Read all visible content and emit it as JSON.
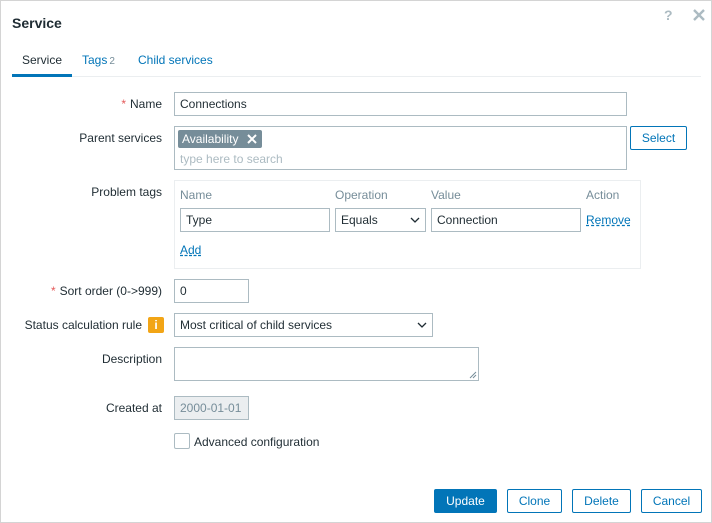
{
  "dialog": {
    "title": "Service",
    "help": "?"
  },
  "tabs": [
    {
      "label": "Service",
      "count": ""
    },
    {
      "label": "Tags",
      "count": "2"
    },
    {
      "label": "Child services",
      "count": ""
    }
  ],
  "form": {
    "name": {
      "label": "Name",
      "value": "Connections"
    },
    "parent_services": {
      "label": "Parent services",
      "selected": [
        "Availability"
      ],
      "placeholder": "type here to search",
      "select_button": "Select"
    },
    "problem_tags": {
      "label": "Problem tags",
      "headers": {
        "name": "Name",
        "operation": "Operation",
        "value": "Value",
        "action": "Action"
      },
      "rows": [
        {
          "name": "Type",
          "operation": "Equals",
          "value": "Connection",
          "action": "Remove"
        }
      ],
      "add_label": "Add"
    },
    "sort_order": {
      "label": "Sort order (0->999)",
      "value": "0"
    },
    "status_rule": {
      "label": "Status calculation rule",
      "info": "i",
      "value": "Most critical of child services"
    },
    "description": {
      "label": "Description",
      "value": ""
    },
    "created_at": {
      "label": "Created at",
      "value": "2000-01-01"
    },
    "advanced": {
      "label": "Advanced configuration",
      "checked": false
    }
  },
  "footer": {
    "update": "Update",
    "clone": "Clone",
    "delete": "Delete",
    "cancel": "Cancel"
  },
  "colors": {
    "accent": "#0275b8",
    "required": "#e45959",
    "chip": "#768d99",
    "info": "#f2a516"
  }
}
